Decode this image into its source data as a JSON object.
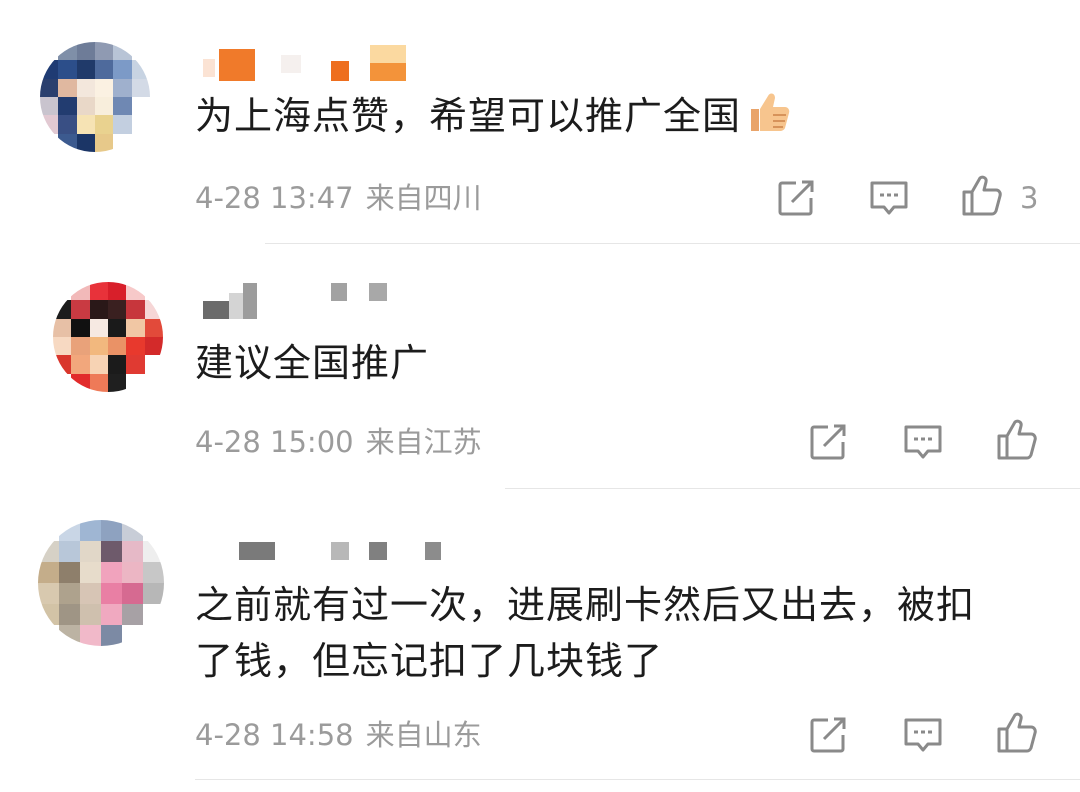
{
  "comments": [
    {
      "text": "为上海点赞，希望可以推广全国",
      "has_emoji": "thumbs-up-emoji",
      "time": "4-28 13:47",
      "location": "来自四川",
      "likes": "3"
    },
    {
      "text": "建议全国推广",
      "time": "4-28 15:00",
      "location": "来自江苏",
      "likes": ""
    },
    {
      "text_line1": "之前就有过一次，进展刷卡然后又出去，被扣",
      "text_line2": "了钱，但忘记扣了几块钱了",
      "time": "4-28 14:58",
      "location": "来自山东",
      "likes": ""
    }
  ],
  "icons": [
    "share-icon",
    "comment-icon",
    "like-icon"
  ],
  "colors": {
    "text": "#1c1c1c",
    "meta": "#9b9b9b",
    "divider": "#e6e6e6"
  }
}
